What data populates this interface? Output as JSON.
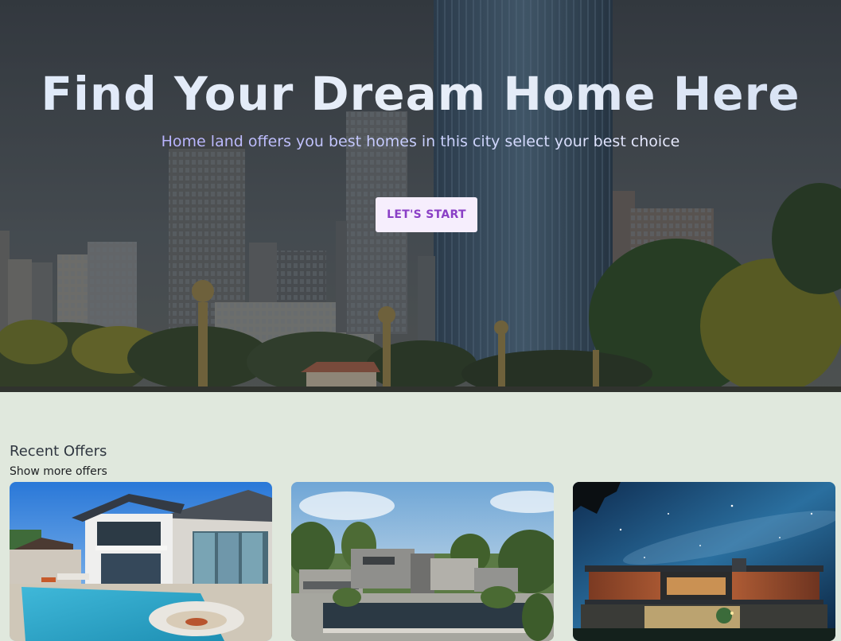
{
  "hero": {
    "title": "Find Your Dream Home Here",
    "subtitle": "Home land offers you best homes in this city select your best choice",
    "cta_label": "LET'S START"
  },
  "offers": {
    "title": "Recent Offers",
    "show_more": "Show more offers",
    "cards": [
      {
        "image": "luxury-pool-villa-photo"
      },
      {
        "image": "modern-courtyard-house-photo"
      },
      {
        "image": "night-sky-modern-house-photo"
      }
    ]
  },
  "colors": {
    "page_background": "#e0e8dd",
    "cta_background": "#f6eefd",
    "cta_text": "#8a3fc6"
  }
}
